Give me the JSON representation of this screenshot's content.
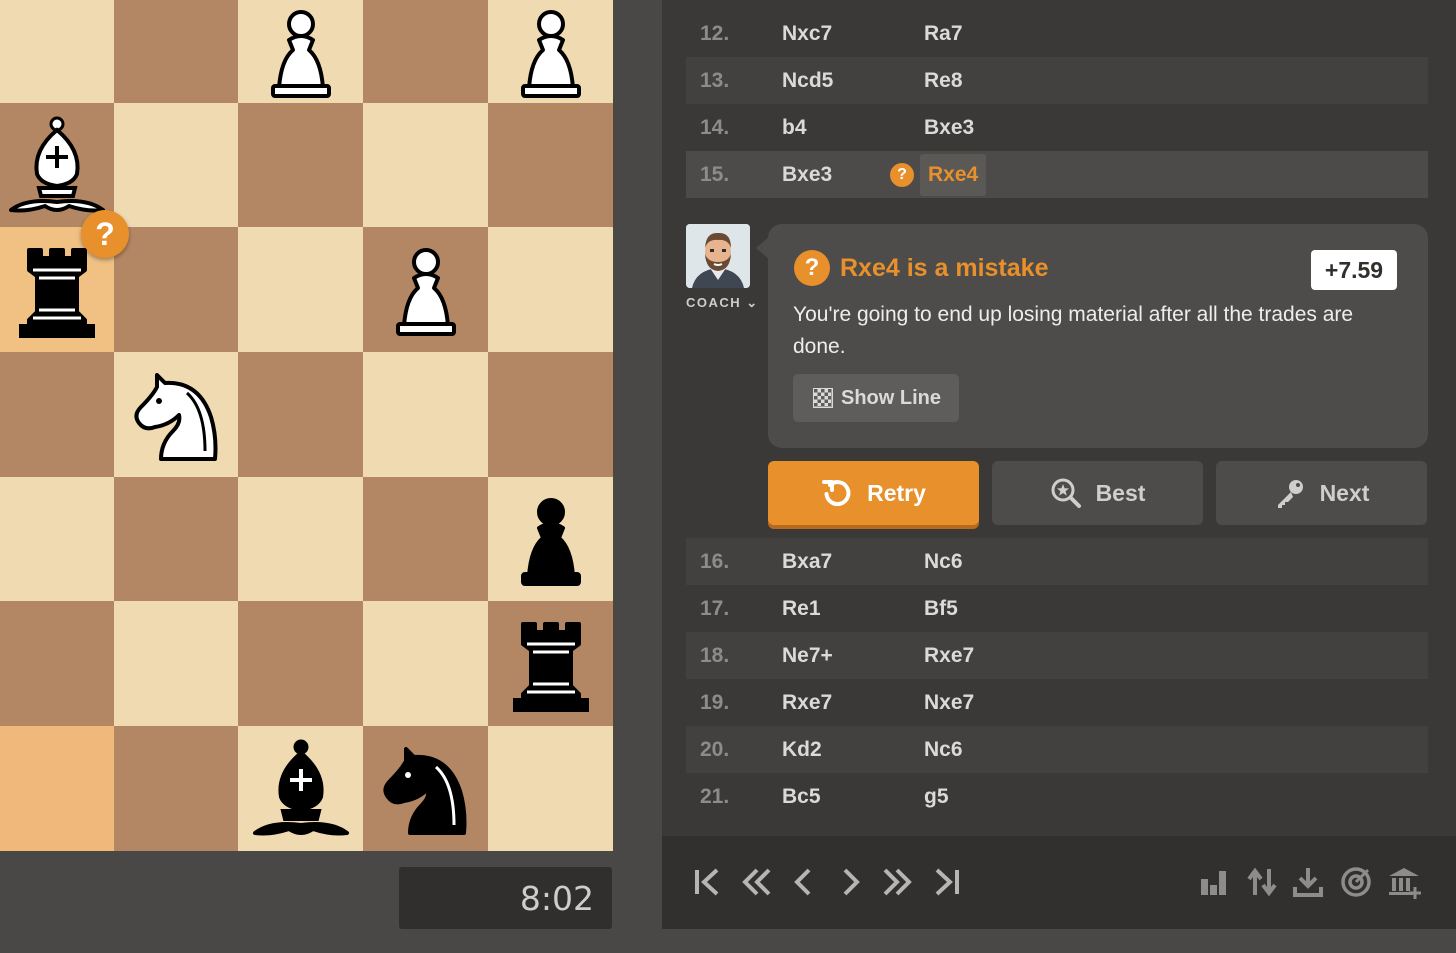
{
  "board": {
    "squares": [
      [
        "light",
        "dark",
        "light",
        "dark",
        "light"
      ],
      [
        "dark",
        "light",
        "dark",
        "light",
        "dark"
      ],
      [
        "hl-light",
        "dark",
        "light",
        "dark",
        "light"
      ],
      [
        "dark",
        "light",
        "dark",
        "light",
        "dark"
      ],
      [
        "light",
        "dark",
        "light",
        "dark",
        "light"
      ],
      [
        "dark",
        "light",
        "dark",
        "light",
        "dark"
      ],
      [
        "hl-dark",
        "dark",
        "light",
        "dark",
        "light"
      ]
    ],
    "pieces": [
      {
        "row": 0,
        "col": 2,
        "piece": "white-pawn"
      },
      {
        "row": 0,
        "col": 4,
        "piece": "white-pawn"
      },
      {
        "row": 1,
        "col": 0,
        "piece": "white-bishop"
      },
      {
        "row": 2,
        "col": 0,
        "piece": "black-rook"
      },
      {
        "row": 2,
        "col": 3,
        "piece": "white-pawn"
      },
      {
        "row": 3,
        "col": 1,
        "piece": "white-knight"
      },
      {
        "row": 4,
        "col": 4,
        "piece": "black-pawn"
      },
      {
        "row": 5,
        "col": 4,
        "piece": "black-rook"
      },
      {
        "row": 6,
        "col": 2,
        "piece": "black-bishop"
      },
      {
        "row": 6,
        "col": 3,
        "piece": "black-knight"
      }
    ],
    "mistake_badge": "?",
    "clock": "8:02"
  },
  "moves_top": [
    {
      "num": "12.",
      "white": "Nxc7",
      "black": "Ra7"
    },
    {
      "num": "13.",
      "white": "Ncd5",
      "black": "Re8"
    },
    {
      "num": "14.",
      "white": "b4",
      "black": "Bxe3"
    },
    {
      "num": "15.",
      "white": "Bxe3",
      "black": "Rxe4"
    }
  ],
  "moves_bottom": [
    {
      "num": "16.",
      "white": "Bxa7",
      "black": "Nc6"
    },
    {
      "num": "17.",
      "white": "Re1",
      "black": "Bf5"
    },
    {
      "num": "18.",
      "white": "Ne7+",
      "black": "Rxe7"
    },
    {
      "num": "19.",
      "white": "Rxe7",
      "black": "Nxe7"
    },
    {
      "num": "20.",
      "white": "Kd2",
      "black": "Nc6"
    },
    {
      "num": "21.",
      "white": "Bc5",
      "black": "g5"
    }
  ],
  "coach": {
    "label": "COACH",
    "title": "Rxe4 is a mistake",
    "eval": "+7.59",
    "message": "You're going to end up losing material after all the trades are done.",
    "show_line": "Show Line",
    "qmark": "?"
  },
  "actions": {
    "retry": "Retry",
    "best": "Best",
    "next": "Next"
  },
  "colors": {
    "accent": "#e8902c",
    "panel": "#3b3937",
    "board_light": "#efdab2",
    "board_dark": "#b48764"
  },
  "nav_icons": [
    "first-move-icon",
    "fast-back-icon",
    "prev-icon",
    "next-icon",
    "fast-forward-icon",
    "last-move-icon",
    "stats-icon",
    "flip-board-icon",
    "download-icon",
    "target-icon",
    "explorer-icon"
  ]
}
